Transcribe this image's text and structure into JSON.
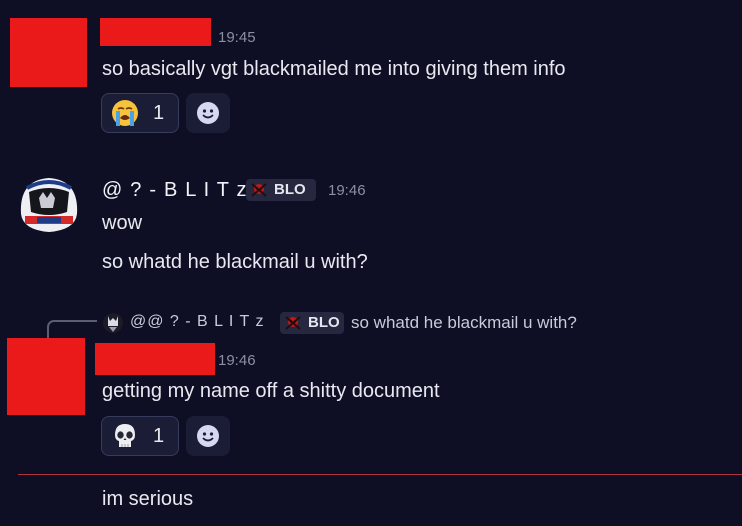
{
  "messages": [
    {
      "time": "19:45",
      "text": "so basically vgt blackmailed me into giving them info",
      "reaction": {
        "emoji": "loudly-crying-face",
        "count": "1"
      }
    },
    {
      "username": "@ ? - B L I T z",
      "tag": "BLO",
      "time": "19:46",
      "lines": [
        "wow",
        "so whatd he blackmail u with?"
      ]
    },
    {
      "reply": {
        "username": "@@ ? - B L I T z",
        "tag": "BLO",
        "text": "so whatd he blackmail u with?"
      },
      "time": "19:46",
      "text": "getting my name off a shitty document",
      "reaction": {
        "emoji": "skull",
        "count": "1"
      }
    },
    {
      "text": "im serious"
    }
  ],
  "colors": {
    "background": "#0e0f24",
    "redaction": "#ea1a1a",
    "new_messages_divider": "#b0323a"
  },
  "icons": {
    "add_reaction": "smiley-add-reaction-icon"
  }
}
